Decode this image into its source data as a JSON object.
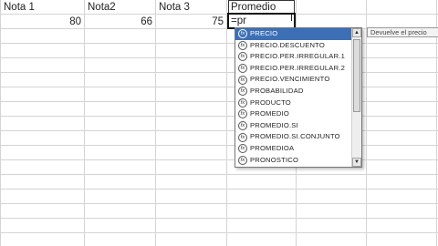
{
  "headers": [
    "Nota 1",
    "Nota2",
    "Nota 3",
    "Promedio"
  ],
  "row1": {
    "a": "80",
    "b": "66",
    "c": "75"
  },
  "edit": {
    "value": "=pr"
  },
  "autocomplete": {
    "items": [
      "PRECIO",
      "PRECIO.DESCUENTO",
      "PRECIO.PER.IRREGULAR.1",
      "PRECIO.PER.IRREGULAR.2",
      "PRECIO.VENCIMIENTO",
      "PROBABILIDAD",
      "PRODUCTO",
      "PROMEDIO",
      "PROMEDIO.SI",
      "PROMEDIO.SI.CONJUNTO",
      "PROMEDIOA",
      "PRONOSTICO"
    ],
    "selected_index": 0,
    "icon": "function-icon"
  },
  "tooltip": {
    "text": "Devuelve el precio"
  },
  "colors": {
    "selection": "#3d6fb6",
    "grid": "#d4d4d4"
  }
}
